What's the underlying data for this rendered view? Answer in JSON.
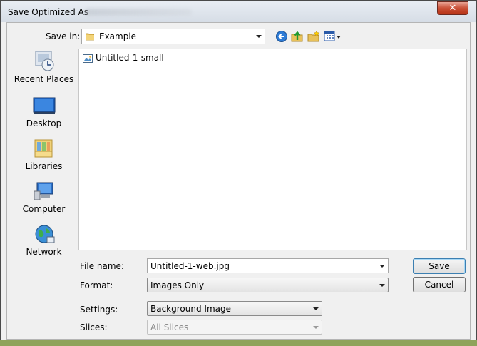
{
  "window": {
    "title": "Save Optimized As",
    "close_label": "✕"
  },
  "toolbar": {
    "save_in_label": "Save in:",
    "save_in_value": "Example"
  },
  "places": [
    {
      "label": "Recent Places"
    },
    {
      "label": "Desktop"
    },
    {
      "label": "Libraries"
    },
    {
      "label": "Computer"
    },
    {
      "label": "Network"
    }
  ],
  "files": [
    {
      "name": "Untitled-1-small"
    }
  ],
  "form": {
    "file_name_label": "File name:",
    "file_name_value": "Untitled-1-web.jpg",
    "format_label": "Format:",
    "format_value": "Images Only",
    "settings_label": "Settings:",
    "settings_value": "Background Image",
    "slices_label": "Slices:",
    "slices_value": "All Slices"
  },
  "buttons": {
    "save": "Save",
    "cancel": "Cancel"
  },
  "colors": {
    "accent": "#3c7fb1",
    "close": "#c94f36",
    "desktop_bg": "#8fa35a"
  }
}
